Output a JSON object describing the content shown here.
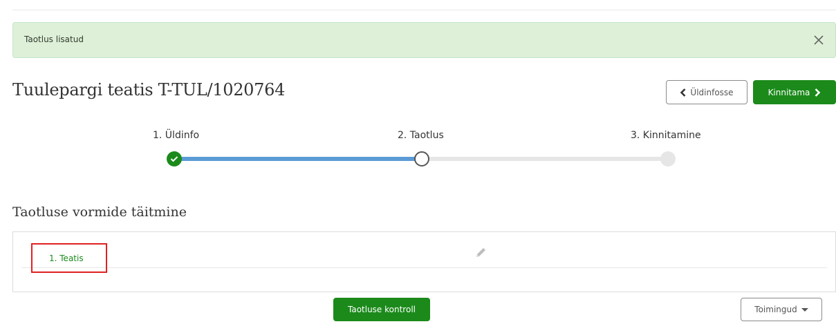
{
  "alert": {
    "message": "Taotlus lisatud"
  },
  "header": {
    "title": "Tuulepargi teatis T-TUL/1020764",
    "back_label": "Üldinfosse",
    "confirm_label": "Kinnitama"
  },
  "steps": [
    {
      "label": "1. Üldinfo",
      "state": "done"
    },
    {
      "label": "2. Taotlus",
      "state": "current"
    },
    {
      "label": "3. Kinnitamine",
      "state": "pending"
    }
  ],
  "forms_section": {
    "title": "Taotluse vormide täitmine",
    "items": [
      {
        "label": "1. Teatis"
      }
    ]
  },
  "footer": {
    "check_label": "Taotluse kontroll",
    "actions_label": "Toimingud"
  },
  "colors": {
    "accent_green": "#1b8a1b",
    "progress_blue": "#5b9bd5",
    "alert_bg": "#dff0d8",
    "highlight_red": "#e02020"
  }
}
